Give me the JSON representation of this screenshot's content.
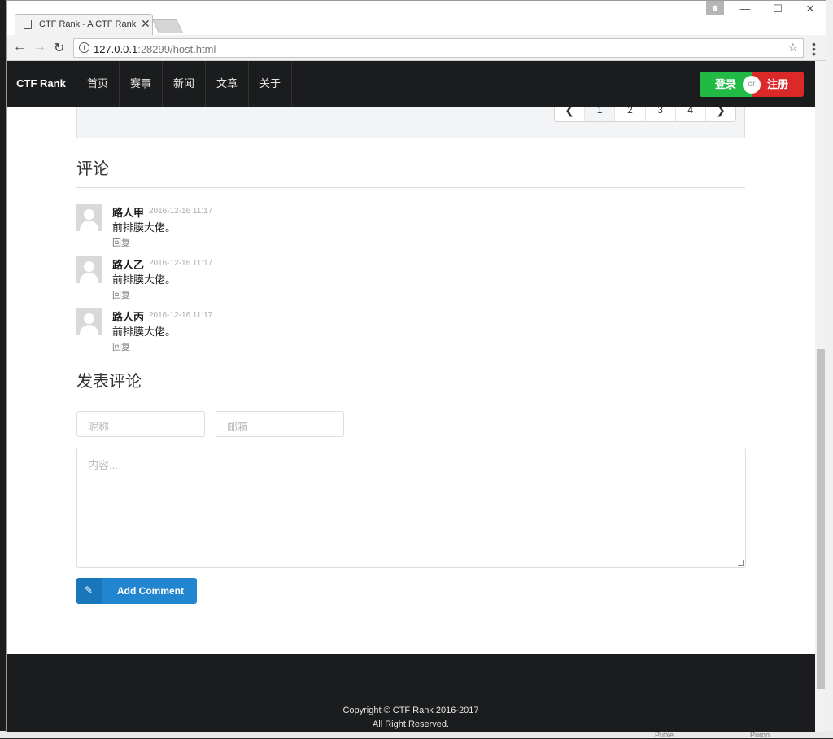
{
  "browser": {
    "tab_title": "CTF Rank - A CTF Rank",
    "tab_close": "✕",
    "url_host": "127.0.0.1",
    "url_rest": ":28299/host.html"
  },
  "site": {
    "brand": "CTF Rank",
    "nav": [
      "首页",
      "赛事",
      "新闻",
      "文章",
      "关于"
    ],
    "login_label": "登录",
    "or_label": "or",
    "register_label": "注册"
  },
  "pagination": {
    "pages": [
      "1",
      "2",
      "3",
      "4"
    ],
    "active": "1"
  },
  "comments_section": {
    "title": "评论",
    "items": [
      {
        "author": "路人甲",
        "date": "2016-12-16 11:17",
        "text": "前排膜大佬。",
        "reply": "回复"
      },
      {
        "author": "路人乙",
        "date": "2016-12-16 11:17",
        "text": "前排膜大佬。",
        "reply": "回复"
      },
      {
        "author": "路人丙",
        "date": "2016-12-16 11:17",
        "text": "前排膜大佬。",
        "reply": "回复"
      }
    ]
  },
  "post_form": {
    "title": "发表评论",
    "nickname_placeholder": "昵称",
    "email_placeholder": "邮箱",
    "content_placeholder": "内容...",
    "submit_label": "Add Comment"
  },
  "footer": {
    "copyright": "Copyright © CTF Rank 2016-2017",
    "rights": "All Right Reserved."
  },
  "desktop_bottom": {
    "label_a": "Puble",
    "label_b": "Purpo"
  },
  "colors": {
    "navbar_bg": "#1b1c1d",
    "login_green": "#21ba45",
    "register_red": "#db2828",
    "submit_blue": "#2185d0"
  }
}
